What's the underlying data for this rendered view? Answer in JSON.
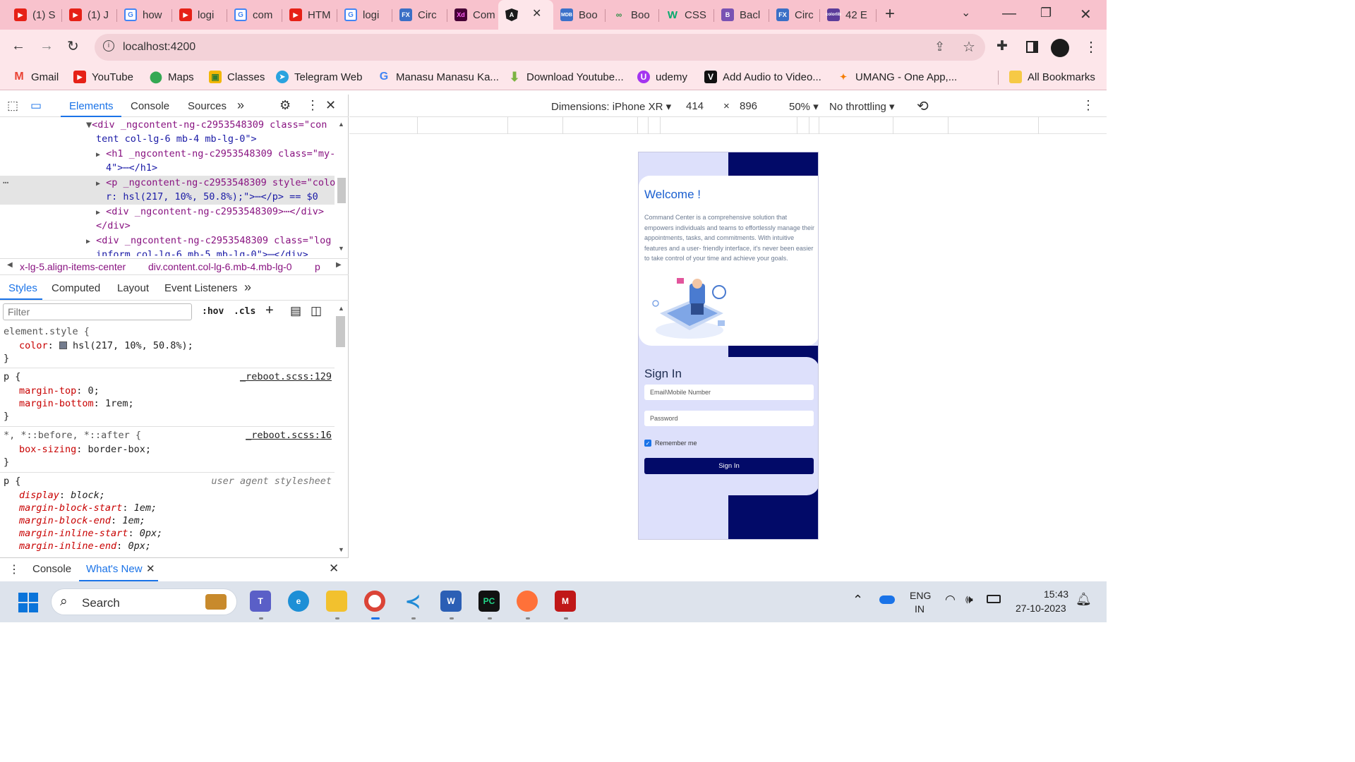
{
  "colors": {
    "tabstrip": "#f8c2cd",
    "toolbar": "#fde6ea",
    "accent_blue": "#1a73e8",
    "navy": "#020a68",
    "phone_bg": "#dde0fb",
    "welcome_blue": "#1a5fd0"
  },
  "browser": {
    "tabs": [
      {
        "icon": "youtube-icon",
        "label": "(1) S"
      },
      {
        "icon": "youtube-icon",
        "label": "(1) J"
      },
      {
        "icon": "google-icon",
        "label": "how"
      },
      {
        "icon": "youtube-icon",
        "label": "logi"
      },
      {
        "icon": "google-icon",
        "label": "com"
      },
      {
        "icon": "youtube-icon",
        "label": "HTM"
      },
      {
        "icon": "google-icon",
        "label": "logi"
      },
      {
        "icon": "fx-icon",
        "label": "Circ"
      },
      {
        "icon": "xd-icon",
        "label": "Com"
      },
      {
        "icon": "angular-icon",
        "label": ""
      },
      {
        "icon": "mdb-icon",
        "label": "Boo"
      },
      {
        "icon": "gfg-icon",
        "label": "Boo"
      },
      {
        "icon": "w3schools-icon",
        "label": "CSS"
      },
      {
        "icon": "bootstrap-icon",
        "label": "Bacl"
      },
      {
        "icon": "fx-icon",
        "label": "Circ"
      },
      {
        "icon": "colorlib-icon",
        "label": "42 E"
      }
    ],
    "url": "localhost:4200",
    "bookmarks": [
      {
        "icon": "gmail-icon",
        "label": "Gmail"
      },
      {
        "icon": "youtube-icon",
        "label": "YouTube"
      },
      {
        "icon": "maps-icon",
        "label": "Maps"
      },
      {
        "icon": "classroom-icon",
        "label": "Classes"
      },
      {
        "icon": "telegram-icon",
        "label": "Telegram Web"
      },
      {
        "icon": "google-icon",
        "label": "Manasu Manasu Ka..."
      },
      {
        "icon": "download-icon",
        "label": "Download Youtube..."
      },
      {
        "icon": "udemy-icon",
        "label": "udemy"
      },
      {
        "icon": "veed-icon",
        "label": "Add Audio to Video..."
      },
      {
        "icon": "umang-icon",
        "label": "UMANG - One App,..."
      },
      {
        "icon": "folder-icon",
        "label": "All Bookmarks"
      }
    ]
  },
  "devtools": {
    "tabs": [
      "Elements",
      "Console",
      "Sources"
    ],
    "more": "»",
    "elements_lines": [
      {
        "arrow": "▼",
        "html": "<div _ngcontent-ng-c2953548309 class=\"con"
      },
      {
        "arrow": "",
        "html": "tent col-lg-6 mb-4 mb-lg-0\">"
      },
      {
        "arrow": "▶",
        "html": "<h1 _ngcontent-ng-c2953548309 class=\"my-"
      },
      {
        "arrow": "",
        "html": "4\">⋯</h1>"
      },
      {
        "arrow": "▶",
        "html": "<p _ngcontent-ng-c2953548309 style=\"colo"
      },
      {
        "arrow": "",
        "html": "r: hsl(217, 10%, 50.8%);\">⋯</p> == $0"
      },
      {
        "arrow": "▶",
        "html": "<div _ngcontent-ng-c2953548309>⋯</div>"
      },
      {
        "arrow": "",
        "html": "</div>"
      },
      {
        "arrow": "▶",
        "html": "<div _ngcontent-ng-c2953548309 class=\"log"
      },
      {
        "arrow": "",
        "html": "inform col-lg-6 mb-5 mb-lg-0\">⋯</div>"
      }
    ],
    "breadcrumbs": [
      "х-lg-5.align-items-center",
      "div.content.col-lg-6.mb-4.mb-lg-0",
      "p"
    ],
    "subtabs": [
      "Styles",
      "Computed",
      "Layout",
      "Event Listeners"
    ],
    "filter_placeholder": "Filter",
    "filter_tools": [
      ":hov",
      ".cls"
    ],
    "styles": [
      {
        "selector": "element.style {",
        "source": "",
        "props": [
          {
            "name": "color",
            "value": "hsl(217, 10%, 50.8%);"
          }
        ]
      },
      {
        "selector": "p {",
        "source": "_reboot.scss:129",
        "props": [
          {
            "name": "margin-top",
            "value": "0;"
          },
          {
            "name": "margin-bottom",
            "value": "1rem;"
          }
        ]
      },
      {
        "selector": "*, *::before, *::after {",
        "source": "_reboot.scss:16",
        "props": [
          {
            "name": "box-sizing",
            "value": "border-box;"
          }
        ]
      },
      {
        "selector": "p {",
        "source": "user agent stylesheet",
        "props": [
          {
            "name": "display",
            "value": "block;"
          },
          {
            "name": "margin-block-start",
            "value": "1em;"
          },
          {
            "name": "margin-block-end",
            "value": "1em;"
          },
          {
            "name": "margin-inline-start",
            "value": "0px;"
          },
          {
            "name": "margin-inline-end",
            "value": "0px;"
          }
        ]
      }
    ],
    "drawer_tabs": [
      "Console",
      "What's New"
    ]
  },
  "device_toolbar": {
    "dimensions": "Dimensions: iPhone XR",
    "width": "414",
    "x": "×",
    "height": "896",
    "zoom": "50%",
    "throttling": "No throttling"
  },
  "app": {
    "welcome_title": "Welcome !",
    "welcome_text": "Command Center is a comprehensive solution that empowers individuals and teams to effortlessly manage their appointments, tasks, and commitments. With intuitive features and a user- friendly interface, it's never been easier to take control of your time and achieve your goals.",
    "signin_title": "Sign In",
    "email_placeholder": "Email\\Mobile Number",
    "password_placeholder": "Password",
    "remember_label": "Remember me",
    "remember_checked": true,
    "signin_button": "Sign In"
  },
  "taskbar": {
    "search_label": "Search",
    "language": "ENG",
    "region": "IN",
    "time": "15:43",
    "date": "27-10-2023"
  }
}
